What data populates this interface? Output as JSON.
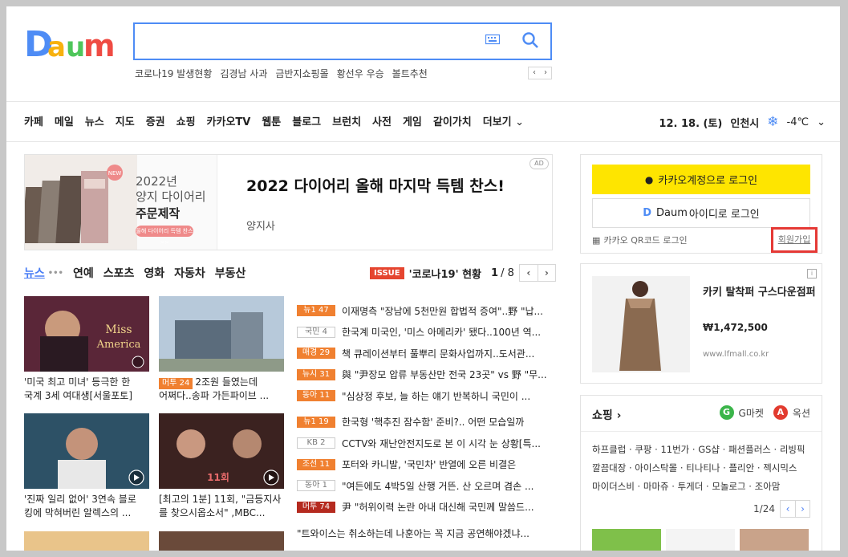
{
  "search": {
    "placeholder": ""
  },
  "trends": [
    "코로나19 발생현황",
    "김경남 사과",
    "금반지쇼핑몰",
    "황선우 우승",
    "볼트추천"
  ],
  "nav": {
    "items": [
      "카페",
      "메일",
      "뉴스",
      "지도",
      "증권",
      "쇼핑",
      "카카오TV",
      "웹툰",
      "블로그",
      "브런치",
      "사전",
      "게임",
      "같이가치",
      "더보기"
    ],
    "date": "12. 18. (토)",
    "city": "인천시",
    "temp": "-4℃"
  },
  "ad": {
    "left_line1": "2022년",
    "left_line2": "양지 다이어리",
    "left_strong": "주문제작",
    "left_pill": "올해 다이어리 득템 찬스 >>",
    "new_badge": "NEW",
    "title": "2022 다이어리 올해 마지막 득템 찬스!",
    "source": "양지사",
    "badge": "AD"
  },
  "news_tabs": [
    "뉴스",
    "연예",
    "스포츠",
    "영화",
    "자동차",
    "부동산"
  ],
  "issue": {
    "badge": "ISSUE",
    "text": "'코로나19' 현황",
    "page": "1",
    "total": "/ 8"
  },
  "thumbs": [
    {
      "tag": "",
      "line1": "'미국 최고 미녀' 등극한 한",
      "line2": "국계 3세 여대생[서울포토]"
    },
    {
      "tag": "머투 24",
      "line1": "2조원 들였는데",
      "line2": "어쩌다..송파 가든파이브 ..."
    },
    {
      "tag": "",
      "line1": "'진짜 일리 없어' 3연속 블로",
      "line2": "킹에 막혀버린 알렉스의 ..."
    },
    {
      "tag": "",
      "line1": "[최고의 1분] 11회, \"금등지사",
      "line2": "를 찾으시옵소서\" ,MBC..."
    }
  ],
  "news": [
    {
      "tag": "뉴1 47",
      "style": "fill",
      "text": "이재명측 \"장남에 5천만원 합법적 증여\"..野 \"납..."
    },
    {
      "tag": "국민 4",
      "style": "line",
      "text": "한국계 미국인, '미스 아메리카' 됐다..100년 역..."
    },
    {
      "tag": "매경 29",
      "style": "fill",
      "text": "책 큐레이션부터 풀뿌리 문화사업까지..도서관..."
    },
    {
      "tag": "뉴시 31",
      "style": "fill",
      "text": "與 \"尹장모 압류 부동산만 전국 23곳\" vs 野 \"무..."
    },
    {
      "tag": "동아 11",
      "style": "fill",
      "text": "\"심상정 후보, 늘 하는 얘기 반복하니 국민이 ..."
    },
    {
      "tag": "뉴1 19",
      "style": "fill",
      "text": "한국형 '핵추진 잠수함' 준비?.. 어떤 모습일까"
    },
    {
      "tag": "KB 2",
      "style": "line",
      "text": "CCTV와 재난안전지도로 본 이 시각 눈 상황[특..."
    },
    {
      "tag": "조선 11",
      "style": "fill",
      "text": "포터와 카니발, '국민차' 반열에 오른 비결은"
    },
    {
      "tag": "동아 1",
      "style": "line",
      "text": "\"여든에도 4박5일 산행 거뜬. 산 오르며 겸손 ..."
    },
    {
      "tag": "머투 74",
      "style": "dark",
      "text": "尹 \"허위이력 논란 아내 대신해 국민께 말씀드..."
    },
    {
      "tag": "",
      "style": "none",
      "text": "\"트와이스는 취소하는데 나훈아는 꼭 지금 공연해야겠냐..."
    }
  ],
  "login": {
    "kakao": "카카오계정으로 로그인",
    "daum_brand": "Daum",
    "daum": "아이디로 로그인",
    "qr": "카카오 QR코드 로그인",
    "signup": "회원가입"
  },
  "product": {
    "title": "카키 탈착퍼 구스다운점퍼",
    "price": "₩1,472,500",
    "url": "www.lfmall.co.kr",
    "info": "i"
  },
  "shopping": {
    "title": "쇼핑 ›",
    "partner1": "G마켓",
    "partner2": "옥션",
    "links": [
      "하프클럽",
      "쿠팡",
      "11번가",
      "GS샵",
      "패션플러스",
      "리빙픽",
      "깔끔대장",
      "아이스탁몰",
      "티나티나",
      "플리안",
      "젝시믹스",
      "마이더스비",
      "마마쥬",
      "투게더",
      "모놀로그",
      "조아맘"
    ],
    "page": "1/24"
  },
  "colors": {
    "accent": "#4a7ef5",
    "kakao": "#fee500",
    "highlight": "#e53935"
  }
}
